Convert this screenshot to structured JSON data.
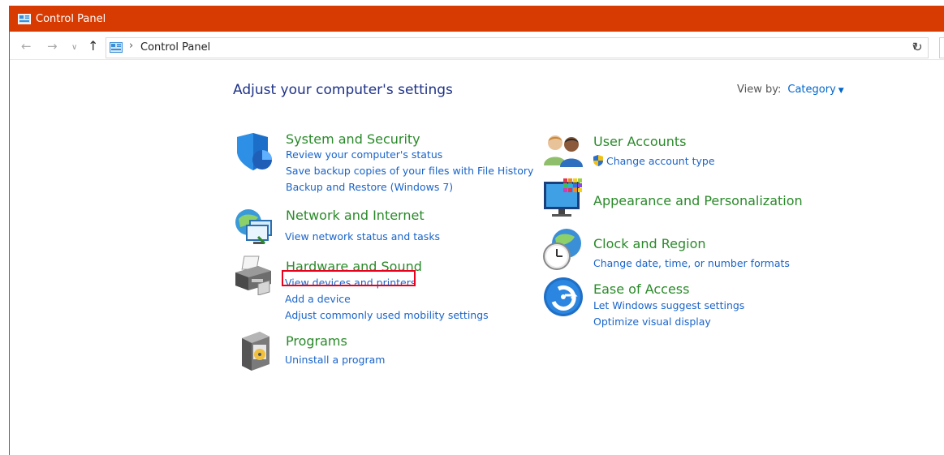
{
  "window": {
    "title": "Control Panel"
  },
  "address": {
    "crumb": "Control Panel",
    "separator": "›"
  },
  "page": {
    "heading": "Adjust your computer's settings",
    "view_by_label": "View by:",
    "view_by_value": "Category"
  },
  "left_categories": [
    {
      "title": "System and Security",
      "links": [
        "Review your computer's status",
        "Save backup copies of your files with File History",
        "Backup and Restore (Windows 7)"
      ]
    },
    {
      "title": "Network and Internet",
      "links": [
        "View network status and tasks"
      ]
    },
    {
      "title": "Hardware and Sound",
      "links": [
        "View devices and printers",
        "Add a device",
        "Adjust commonly used mobility settings"
      ]
    },
    {
      "title": "Programs",
      "links": [
        "Uninstall a program"
      ]
    }
  ],
  "right_categories": [
    {
      "title": "User Accounts",
      "links": [
        "Change account type"
      ]
    },
    {
      "title": "Appearance and Personalization",
      "links": []
    },
    {
      "title": "Clock and Region",
      "links": [
        "Change date, time, or number formats"
      ]
    },
    {
      "title": "Ease of Access",
      "links": [
        "Let Windows suggest settings",
        "Optimize visual display"
      ]
    }
  ],
  "icons": {
    "system_security": "shield-icon",
    "network": "network-icon",
    "hardware": "printer-icon",
    "programs": "programs-icon",
    "user_accounts": "users-icon",
    "appearance": "monitor-icon",
    "clock": "clock-globe-icon",
    "ease": "ease-of-access-icon"
  },
  "colors": {
    "titlebar": "#d83b01",
    "category_title": "#2a8a2a",
    "link": "#1a64c8",
    "heading": "#1e3287",
    "highlight": "#e8001c"
  }
}
